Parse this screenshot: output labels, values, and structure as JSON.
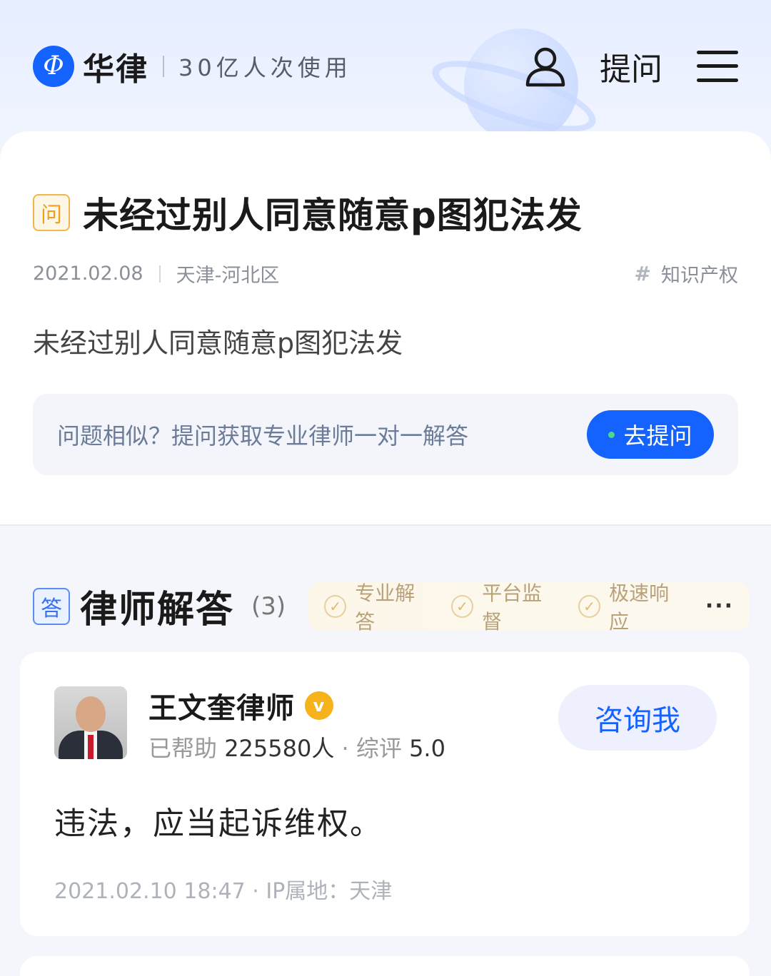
{
  "header": {
    "logo_mark": "Φ",
    "logo_text": "华律",
    "slogan": "30亿人次使用",
    "ask_label": "提问"
  },
  "question": {
    "badge": "问",
    "title": "未经过别人同意随意p图犯法发",
    "date": "2021.02.08",
    "location": "天津-河北区",
    "tag_icon": "#",
    "tag": "知识产权",
    "body": "未经过别人同意随意p图犯法发",
    "cta_text": "问题相似？提问获取专业律师一对一解答",
    "cta_button": "去提问"
  },
  "answers": {
    "badge": "答",
    "title": "律师解答",
    "count": "(3)",
    "features": [
      "专业解答",
      "平台监督",
      "极速响应"
    ],
    "check_glyph": "✓",
    "more": "···",
    "items": [
      {
        "lawyer_name": "王文奎律师",
        "verified_glyph": "v",
        "helped_label": "已帮助 ",
        "helped_count": "225580人",
        "rating_label": " · 综评 ",
        "rating": "5.0",
        "consult_button": "咨询我",
        "answer": "违法，应当起诉维权。",
        "meta": "2021.02.10 18:47 · IP属地：天津"
      }
    ]
  },
  "colors": {
    "brand_blue": "#1563ff",
    "question_badge": "#f0a020",
    "verified_gold": "#f6b21b"
  },
  "icons": [
    "logo-icon",
    "user-icon",
    "menu-icon",
    "hashtag-icon",
    "check-circle-icon",
    "verified-icon",
    "more-icon"
  ]
}
